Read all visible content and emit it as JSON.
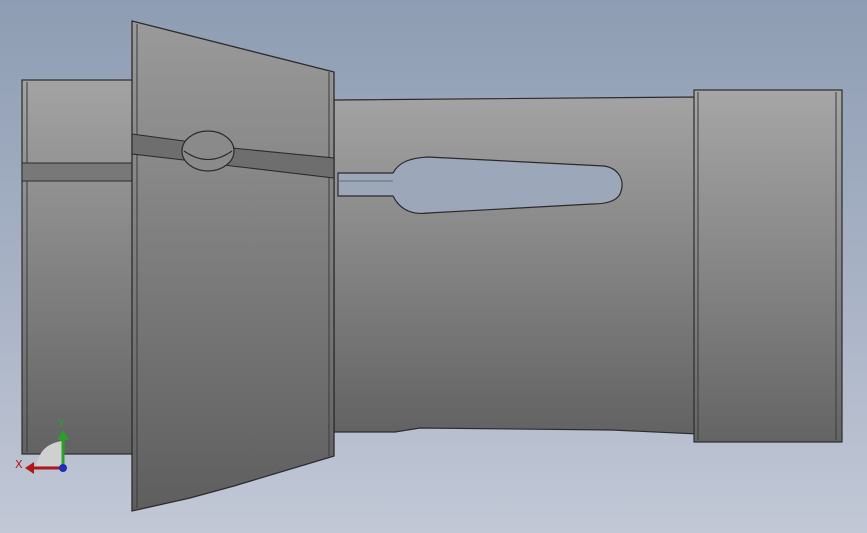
{
  "viewport": {
    "model": "collet",
    "background_top": "#8e9db3",
    "background_bottom": "#c2c8d6"
  },
  "triad": {
    "x_label": "X",
    "y_label": "Y",
    "x_color": "#b01818",
    "y_color": "#2aa02a",
    "z_color": "#1c2fb8"
  }
}
